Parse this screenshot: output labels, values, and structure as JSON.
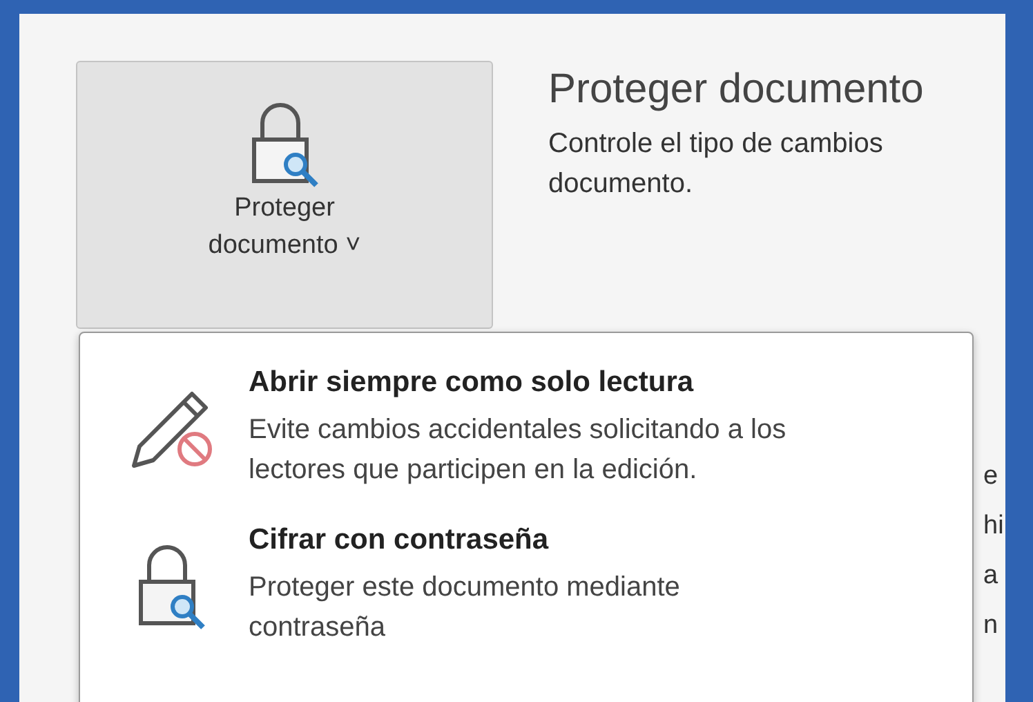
{
  "protect_button": {
    "label_line_1": "Proteger",
    "label_line_2": "documento",
    "caret": "˅"
  },
  "info": {
    "title": "Proteger documento",
    "description": "Controle el tipo de cambios\ndocumento."
  },
  "menu": {
    "items": [
      {
        "kind": "read-only",
        "title": "Abrir siempre como solo lectura",
        "description": "Evite cambios accidentales solicitando a los lectores que participen en la edición."
      },
      {
        "kind": "encrypt",
        "title": "Cifrar con contraseña",
        "description": "Proteger este documento mediante contraseña"
      }
    ]
  },
  "background_text": [
    "e",
    "hi",
    "a",
    "n"
  ]
}
